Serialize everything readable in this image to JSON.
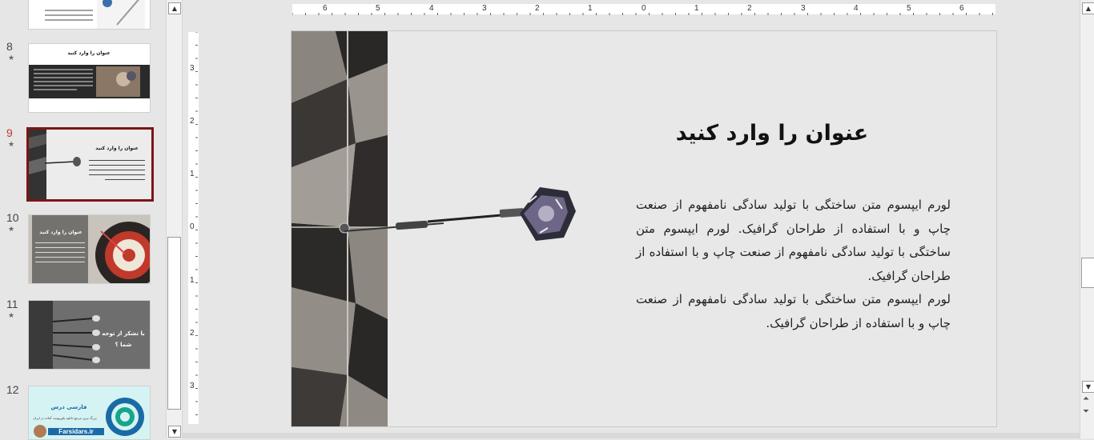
{
  "thumbnails": [
    {
      "number": "8",
      "title": "عنوان را وارد کنید"
    },
    {
      "number": "9",
      "title": "عنوان را وارد کنید"
    },
    {
      "number": "10",
      "title": "عنوان را وارد کنید"
    },
    {
      "number": "11",
      "title": "با تشکر از توجه شما ؟"
    },
    {
      "number": "12",
      "brand": "فارسی درس",
      "tagline": "بزرگ ترین مرجع دانلود پاورپوینت آماده در ایران",
      "url": "Farsidars.ir"
    }
  ],
  "slide_marker": "★",
  "ruler": {
    "horizontal": [
      "6",
      "5",
      "4",
      "3",
      "2",
      "1",
      "0",
      "1",
      "2",
      "3",
      "4",
      "5",
      "6"
    ],
    "vertical": [
      "3",
      "2",
      "1",
      "0",
      "1",
      "2",
      "3"
    ]
  },
  "slide": {
    "title": "عنوان را وارد کنید",
    "paragraph1": "لورم ایپسوم متن ساختگی با تولید سادگی نامفهوم از صنعت چاپ و با استفاده از طراحان گرافیک. لورم ایپسوم متن ساختگی با تولید سادگی نامفهوم از صنعت چاپ و با استفاده از طراحان گرافیک.",
    "paragraph2": "لورم ایپسوم متن ساختگی با تولید سادگی نامفهوم از صنعت چاپ و با استفاده از طراحان گرافیک."
  },
  "scroll_icons": {
    "up": "▲",
    "down": "▼"
  }
}
